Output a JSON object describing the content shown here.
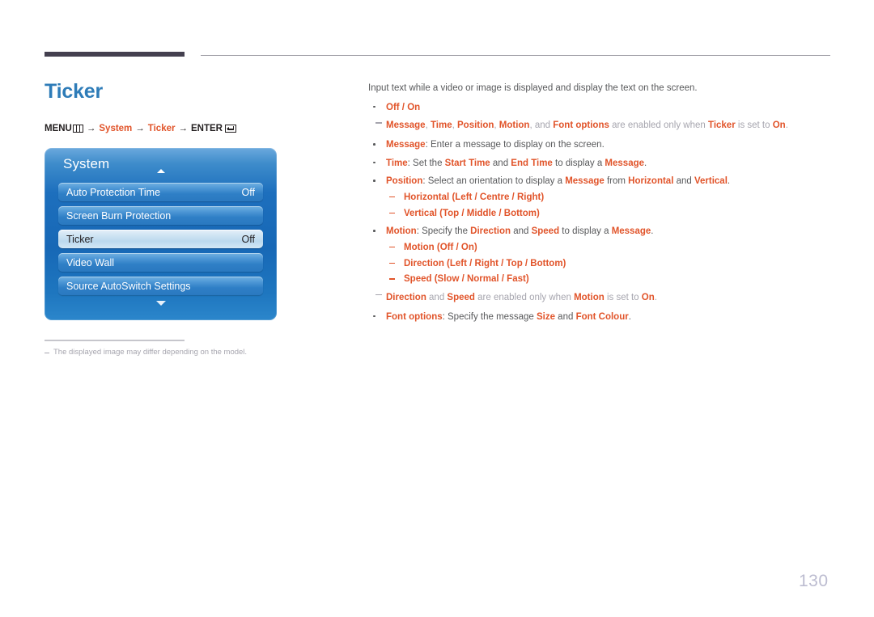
{
  "page": {
    "title": "Ticker",
    "number": "130"
  },
  "breadcrumb": {
    "menu_label": "MENU",
    "menu_icon": "menu-grid-icon",
    "system_label": "System",
    "ticker_label": "Ticker",
    "enter_label": "ENTER",
    "enter_icon": "enter-return-icon",
    "separator": "→"
  },
  "osd": {
    "title": "System",
    "scroll_up_icon": "chevron-up-icon",
    "scroll_down_icon": "chevron-down-icon",
    "rows": [
      {
        "label": "Auto Protection Time",
        "value": "Off",
        "selected": false
      },
      {
        "label": "Screen Burn Protection",
        "value": "",
        "selected": false
      },
      {
        "label": "Ticker",
        "value": "Off",
        "selected": true
      },
      {
        "label": "Video Wall",
        "value": "",
        "selected": false
      },
      {
        "label": "Source AutoSwitch Settings",
        "value": "",
        "selected": false
      }
    ]
  },
  "footnote": {
    "text": "The displayed image may differ depending on the model."
  },
  "content": {
    "intro": "Input text while a video or image is displayed and display the text on the screen.",
    "b1": {
      "label": "Off / On"
    },
    "note1": {
      "t1": "Message",
      "s1": ", ",
      "t2": "Time",
      "s2": ", ",
      "t3": "Position",
      "s3": ", ",
      "t4": "Motion",
      "s4": ", and ",
      "t5": "Font options",
      "s5": " are enabled only when ",
      "t6": "Ticker",
      "s6": " is set to ",
      "t7": "On",
      "s7": "."
    },
    "b2": {
      "label": "Message",
      "rest": ": Enter a message to display on the screen."
    },
    "b3": {
      "label": "Time",
      "t1": ": Set the ",
      "t2": "Start Time",
      "t3": " and ",
      "t4": "End Time",
      "t5": " to display a ",
      "t6": "Message",
      "t7": "."
    },
    "b4": {
      "label": "Position",
      "t1": ": Select an orientation to display a ",
      "t2": "Message",
      "t3": " from ",
      "t4": "Horizontal",
      "t5": " and ",
      "t6": "Vertical",
      "t7": ".",
      "sub": [
        {
          "name": "Horizontal",
          "options": "(Left / Centre / Right)"
        },
        {
          "name": "Vertical",
          "options": "(Top / Middle / Bottom)"
        }
      ]
    },
    "b5": {
      "label": "Motion",
      "t1": ": Specify the ",
      "t2": "Direction",
      "t3": " and ",
      "t4": "Speed",
      "t5": " to display a ",
      "t6": "Message",
      "t7": ".",
      "sub": [
        {
          "name": "Motion",
          "options": "(Off / On)"
        },
        {
          "name": "Direction",
          "options": "(Left / Right / Top / Bottom)"
        },
        {
          "name": "Speed",
          "options": "(Slow / Normal / Fast)"
        }
      ]
    },
    "note2": {
      "t1": "Direction",
      "s1": " and ",
      "t2": "Speed",
      "s2": " are enabled only when ",
      "t3": "Motion",
      "s3": " is set to ",
      "t4": "On",
      "s4": "."
    },
    "b6": {
      "label": "Font options",
      "t1": ": Specify the message ",
      "t2": "Size",
      "t3": " and ",
      "t4": "Font Colour",
      "t5": "."
    }
  }
}
